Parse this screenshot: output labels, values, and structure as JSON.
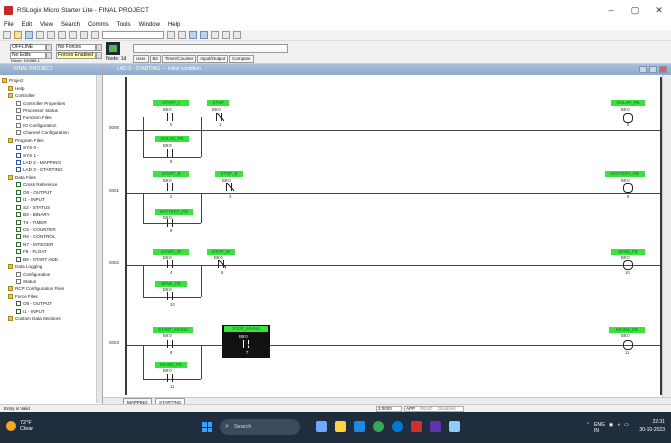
{
  "window": {
    "title": "RSLogix Micro Starter Lite - FINAL PROJECT",
    "controls": [
      "–",
      "▢",
      "✕"
    ]
  },
  "menu": [
    "File",
    "Edit",
    "View",
    "Search",
    "Comms",
    "Tools",
    "Window",
    "Help"
  ],
  "status_panel": {
    "mode": "OFFLINE",
    "forces": "No Forces",
    "edits": "No Edits",
    "forces_enabled": "Forces Enabled",
    "driver": "Driver: DH485-1",
    "node": "Node: 1d",
    "instruction_tabs": [
      "User",
      "Bit",
      "Timer/Counter",
      "Input/Output",
      "Compare"
    ]
  },
  "project_pane": {
    "title": "FINAL PROJECT",
    "items": [
      "Project",
      "Help",
      "Controller",
      "Controller Properties",
      "Processor Status",
      "Function Files",
      "IO Configuration",
      "Channel Configuration",
      "Program Files",
      "SYS 0 -",
      "SYS 1 -",
      "LAD 2 - MAPPING",
      "LAD 3 - STARTING",
      "Data Files",
      "Cross Reference",
      "O0 - OUTPUT",
      "I1 - INPUT",
      "S2 - STATUS",
      "B3 - BINARY",
      "T4 - TIMER",
      "C5 - COUNTER",
      "R6 - CONTROL",
      "N7 - INTEGER",
      "F8 - FLOAT",
      "B9 - START ADD",
      "Data Logging",
      "Configuration",
      "Status",
      "RCP Configuration Files",
      "Force Files",
      "O0 - OUTPUT",
      "I1 - INPUT",
      "Custom Data Monitors"
    ]
  },
  "ladder": {
    "title": "LAD 3 - STARTING --- initial condition",
    "rungs": [
      {
        "num": "0000",
        "input": "START_I",
        "input_addr": "B9:0",
        "input_bit": "0",
        "stop": "STOP",
        "stop_addr": "B9:0",
        "stop_bit": "1",
        "seal": "SOLAR_PB",
        "seal_addr": "B9:0",
        "seal_bit": "8",
        "coil": "SOLAR_PB",
        "coil_addr": "B9:0",
        "coil_bit": "8"
      },
      {
        "num": "0001",
        "input": "START_B",
        "input_addr": "B9:0",
        "input_bit": "2",
        "stop": "STOP_B",
        "stop_addr": "B9:0",
        "stop_bit": "3",
        "seal": "BATTERY_PB",
        "seal_addr": "B9:0",
        "seal_bit": "9",
        "coil": "BATTERY_PB",
        "coil_addr": "B9:0",
        "coil_bit": "9"
      },
      {
        "num": "0002",
        "input": "START_W",
        "input_addr": "B9:0",
        "input_bit": "4",
        "stop": "STOP_W",
        "stop_addr": "B9:0",
        "stop_bit": "5",
        "seal": "WIND_PB",
        "seal_addr": "B9:0",
        "seal_bit": "10",
        "coil": "WIND_PB",
        "coil_addr": "B9:0",
        "coil_bit": "10"
      },
      {
        "num": "0003",
        "input": "START_MAINS",
        "input_addr": "B9:0",
        "input_bit": "6",
        "stop": "STOP_MAINS",
        "stop_addr": "B9:0",
        "stop_bit": "7",
        "seal": "MAINS_PB",
        "seal_addr": "B9:0",
        "seal_bit": "11",
        "coil": "MAINS_PB",
        "coil_addr": "B9:0",
        "coil_bit": "11"
      }
    ],
    "tabs": [
      "MAPPING",
      "STARTING"
    ]
  },
  "statusbar": {
    "left": "Entry is Valid",
    "pos": "3:0003",
    "mode": "APP",
    "read": "READ",
    "disabled": "Disabled"
  },
  "taskbar": {
    "weather_temp": "72°F",
    "weather_desc": "Clear",
    "search": "Search",
    "lang": "ENG\nIN",
    "time": "22:31",
    "date": "30-10-2023"
  },
  "colors": {
    "tag_green": "#3ee03e",
    "titlebar_blue": "#8eaacb",
    "taskbar": "#1f2d3d"
  }
}
